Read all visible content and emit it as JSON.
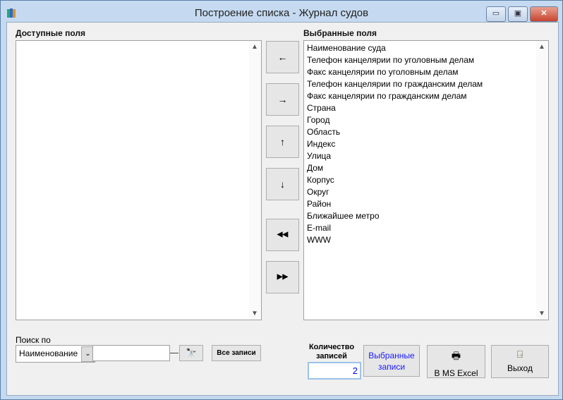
{
  "window": {
    "title": "Построение списка - Журнал судов",
    "minimize": "▭",
    "maximize": "▣",
    "close": "✕"
  },
  "available": {
    "label": "Доступные поля",
    "items": []
  },
  "selected": {
    "label": "Выбранные поля",
    "items": [
      "Наименование суда",
      "Телефон канцелярии по уголовным делам",
      "Факс канцелярии по уголовным делам",
      "Телефон канцелярии по гражданским делам",
      "Факс канцелярии по гражданским делам",
      "Страна",
      "Город",
      "Область",
      "Индекс",
      "Улица",
      "Дом",
      "Корпус",
      "Округ",
      "Район",
      "Ближайшее метро",
      "E-mail",
      "WWW"
    ]
  },
  "arrows": [
    "←",
    "→",
    "↑",
    "↓",
    "◀◀",
    "▶▶"
  ],
  "search": {
    "label": "Поиск по",
    "field": "Наименование",
    "value": "",
    "all_records": "Все записи"
  },
  "count": {
    "label": "Количество записей",
    "value": "2"
  },
  "buttons": {
    "selected_records": "Выбранные записи",
    "excel": "В MS Excel",
    "exit": "Выход"
  }
}
